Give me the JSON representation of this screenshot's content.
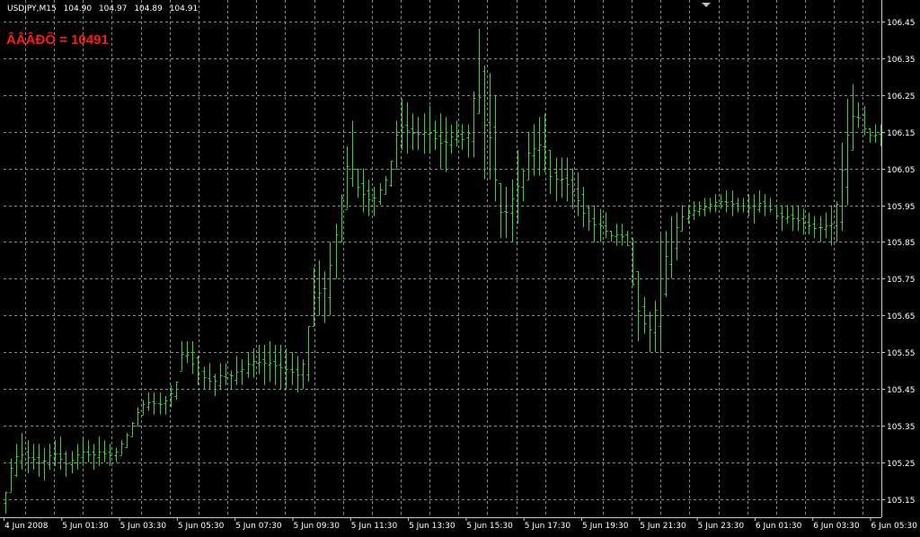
{
  "header": {
    "symbol": "USDJPY,M15",
    "open": "104.90",
    "high": "104.97",
    "low": "104.89",
    "close": "104.91"
  },
  "indicator": {
    "label": "ÂÂÂÐÕ = 10491"
  },
  "colors": {
    "background": "#000000",
    "bars": "#39d339",
    "grid": "#8a8a8a",
    "axis_text": "#ffffff",
    "indicator": "#ff1a1a"
  },
  "chart_data": {
    "type": "ohlc",
    "title": "",
    "xlabel": "",
    "ylabel": "",
    "grid": true,
    "ylim": [
      105.1,
      106.5
    ],
    "y_ticks": [
      "106.45",
      "106.35",
      "106.25",
      "106.15",
      "106.05",
      "105.95",
      "105.85",
      "105.75",
      "105.65",
      "105.55",
      "105.45",
      "105.35",
      "105.25",
      "105.15"
    ],
    "x_ticks": [
      "4 Jun 2008",
      "5 Jun 01:30",
      "5 Jun 03:30",
      "5 Jun 05:30",
      "5 Jun 07:30",
      "5 Jun 09:30",
      "5 Jun 11:30",
      "5 Jun 13:30",
      "5 Jun 15:30",
      "5 Jun 17:30",
      "5 Jun 19:30",
      "5 Jun 21:30",
      "5 Jun 23:30",
      "6 Jun 01:30",
      "6 Jun 03:30",
      "6 Jun 05:30"
    ],
    "highs": [
      105.17,
      105.26,
      105.3,
      105.33,
      105.31,
      105.3,
      105.3,
      105.29,
      105.3,
      105.31,
      105.32,
      105.28,
      105.28,
      105.3,
      105.32,
      105.31,
      105.3,
      105.32,
      105.31,
      105.3,
      105.29,
      105.31,
      105.33,
      105.36,
      105.4,
      105.42,
      105.44,
      105.44,
      105.44,
      105.43,
      105.46,
      105.47,
      105.58,
      105.58,
      105.58,
      105.54,
      105.51,
      105.52,
      105.49,
      105.52,
      105.52,
      105.5,
      105.54,
      105.53,
      105.55,
      105.56,
      105.57,
      105.57,
      105.58,
      105.57,
      105.57,
      105.56,
      105.55,
      105.54,
      105.53,
      105.62,
      105.78,
      105.8,
      105.77,
      105.85,
      105.9,
      105.98,
      106.11,
      106.18,
      106.05,
      106.05,
      106.02,
      106.0,
      106.01,
      106.03,
      106.07,
      106.18,
      106.24,
      106.23,
      106.2,
      106.19,
      106.2,
      106.22,
      106.18,
      106.2,
      106.19,
      106.17,
      106.18,
      106.17,
      106.17,
      106.26,
      106.43,
      106.33,
      106.31,
      106.25,
      106.01,
      106.0,
      106.02,
      106.1,
      106.05,
      106.15,
      106.17,
      106.19,
      106.2,
      106.1,
      106.08,
      106.08,
      106.08,
      106.05,
      106.04,
      106.0,
      105.95,
      105.95,
      105.94,
      105.93,
      105.88,
      105.9,
      105.9,
      105.88,
      105.86,
      105.77,
      105.7,
      105.66,
      105.69,
      105.87,
      105.88,
      105.92,
      105.93,
      105.95,
      105.95,
      105.96,
      105.96,
      105.97,
      105.97,
      105.98,
      105.98,
      105.99,
      105.99,
      105.97,
      105.97,
      105.98,
      105.98,
      105.99,
      105.98,
      105.97,
      105.95,
      105.95,
      105.95,
      105.95,
      105.95,
      105.94,
      105.93,
      105.92,
      105.92,
      105.93,
      105.95,
      105.96,
      106.12,
      106.24,
      106.28,
      106.23,
      106.22,
      106.16,
      106.17,
      106.17
    ],
    "lows": [
      105.11,
      105.17,
      105.21,
      105.23,
      105.22,
      105.23,
      105.21,
      105.2,
      105.23,
      105.24,
      105.23,
      105.21,
      105.22,
      105.23,
      105.24,
      105.25,
      105.23,
      105.24,
      105.25,
      105.24,
      105.25,
      105.27,
      105.29,
      105.32,
      105.35,
      105.38,
      105.39,
      105.38,
      105.38,
      105.38,
      105.4,
      105.42,
      105.5,
      105.52,
      105.49,
      105.46,
      105.45,
      105.45,
      105.43,
      105.45,
      105.46,
      105.45,
      105.46,
      105.46,
      105.48,
      105.48,
      105.49,
      105.46,
      105.47,
      105.46,
      105.45,
      105.45,
      105.46,
      105.44,
      105.45,
      105.47,
      105.62,
      105.65,
      105.63,
      105.65,
      105.75,
      105.85,
      105.94,
      106.0,
      105.97,
      105.93,
      105.92,
      105.92,
      105.95,
      105.98,
      106.0,
      106.05,
      106.1,
      106.09,
      106.1,
      106.1,
      106.09,
      106.09,
      106.1,
      106.05,
      106.04,
      106.09,
      106.11,
      106.1,
      106.08,
      106.08,
      106.2,
      106.02,
      106.02,
      105.96,
      105.86,
      105.86,
      105.85,
      105.9,
      105.96,
      106.02,
      106.03,
      106.03,
      106.04,
      105.98,
      105.96,
      105.97,
      105.96,
      105.94,
      105.92,
      105.89,
      105.88,
      105.85,
      105.85,
      105.86,
      105.85,
      105.84,
      105.84,
      105.84,
      105.73,
      105.58,
      105.6,
      105.55,
      105.55,
      105.55,
      105.7,
      105.75,
      105.8,
      105.88,
      105.9,
      105.91,
      105.92,
      105.92,
      105.93,
      105.93,
      105.94,
      105.93,
      105.92,
      105.93,
      105.93,
      105.92,
      105.9,
      105.93,
      105.92,
      105.93,
      105.91,
      105.88,
      105.9,
      105.88,
      105.88,
      105.87,
      105.87,
      105.86,
      105.85,
      105.86,
      105.84,
      105.85,
      105.88,
      105.95,
      106.1,
      106.16,
      106.14,
      106.12,
      106.12,
      106.11,
      106.1
    ]
  }
}
